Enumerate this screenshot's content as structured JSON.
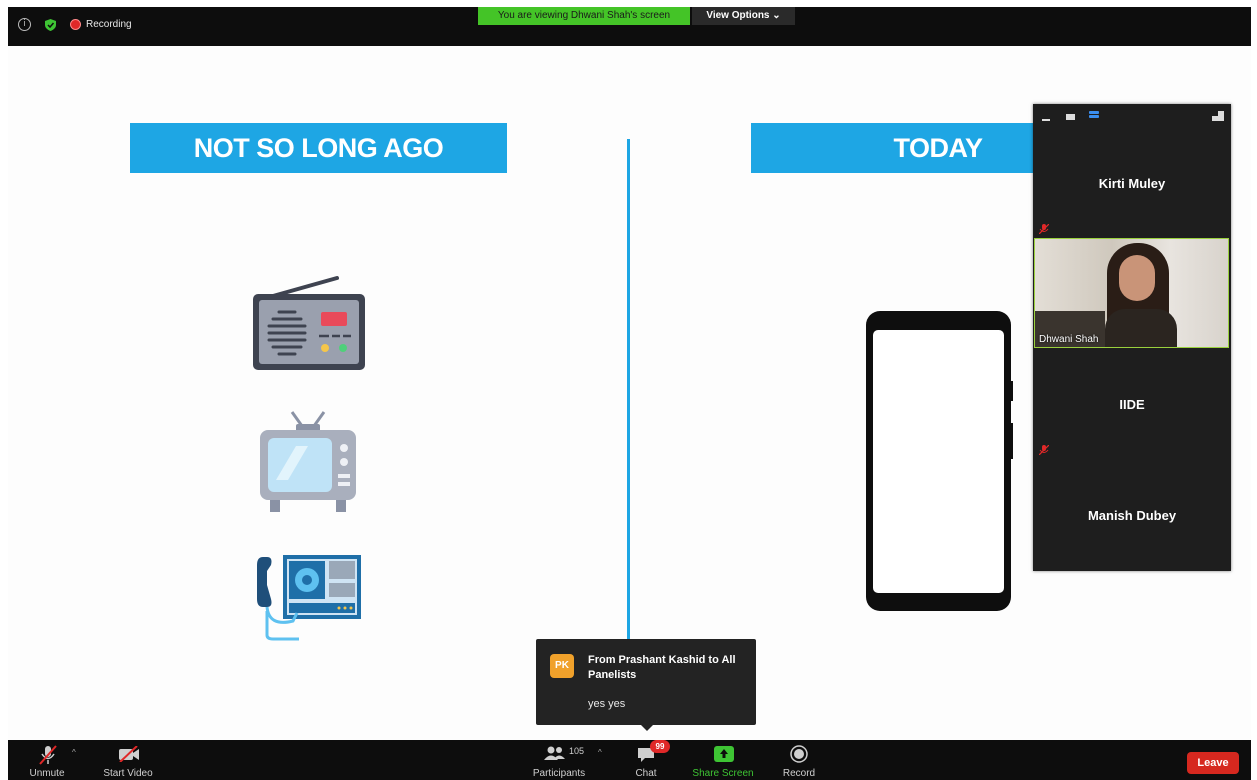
{
  "top_bar": {
    "recording_label": "Recording",
    "viewing_banner": "You are viewing Dhwani Shah's screen",
    "view_options_label": "View Options ⌄",
    "info_icon": "i"
  },
  "slide": {
    "left_heading": "NOT SO LONG AGO",
    "right_heading": "TODAY",
    "left_icons": [
      "radio-icon",
      "television-icon",
      "telephone-icon"
    ],
    "right_icons": [
      "smartphone-icon"
    ],
    "accent_color": "#1ea6e4"
  },
  "gallery": {
    "participants": [
      {
        "name": "Kirti Muley",
        "muted": true,
        "video": false
      },
      {
        "name": "Dhwani Shah",
        "muted": false,
        "video": true
      },
      {
        "name": "IIDE",
        "muted": true,
        "video": false
      },
      {
        "name": "Manish Dubey",
        "muted": false,
        "video": false
      }
    ]
  },
  "chat_popup": {
    "avatar_initials": "PK",
    "from": "From Prashant Kashid to All Panelists",
    "message": "yes yes"
  },
  "toolbar": {
    "unmute_label": "Unmute",
    "start_video_label": "Start Video",
    "participants_label": "Participants",
    "participants_count": "105",
    "chat_label": "Chat",
    "chat_badge": "99",
    "share_screen_label": "Share Screen",
    "record_label": "Record",
    "leave_label": "Leave"
  }
}
